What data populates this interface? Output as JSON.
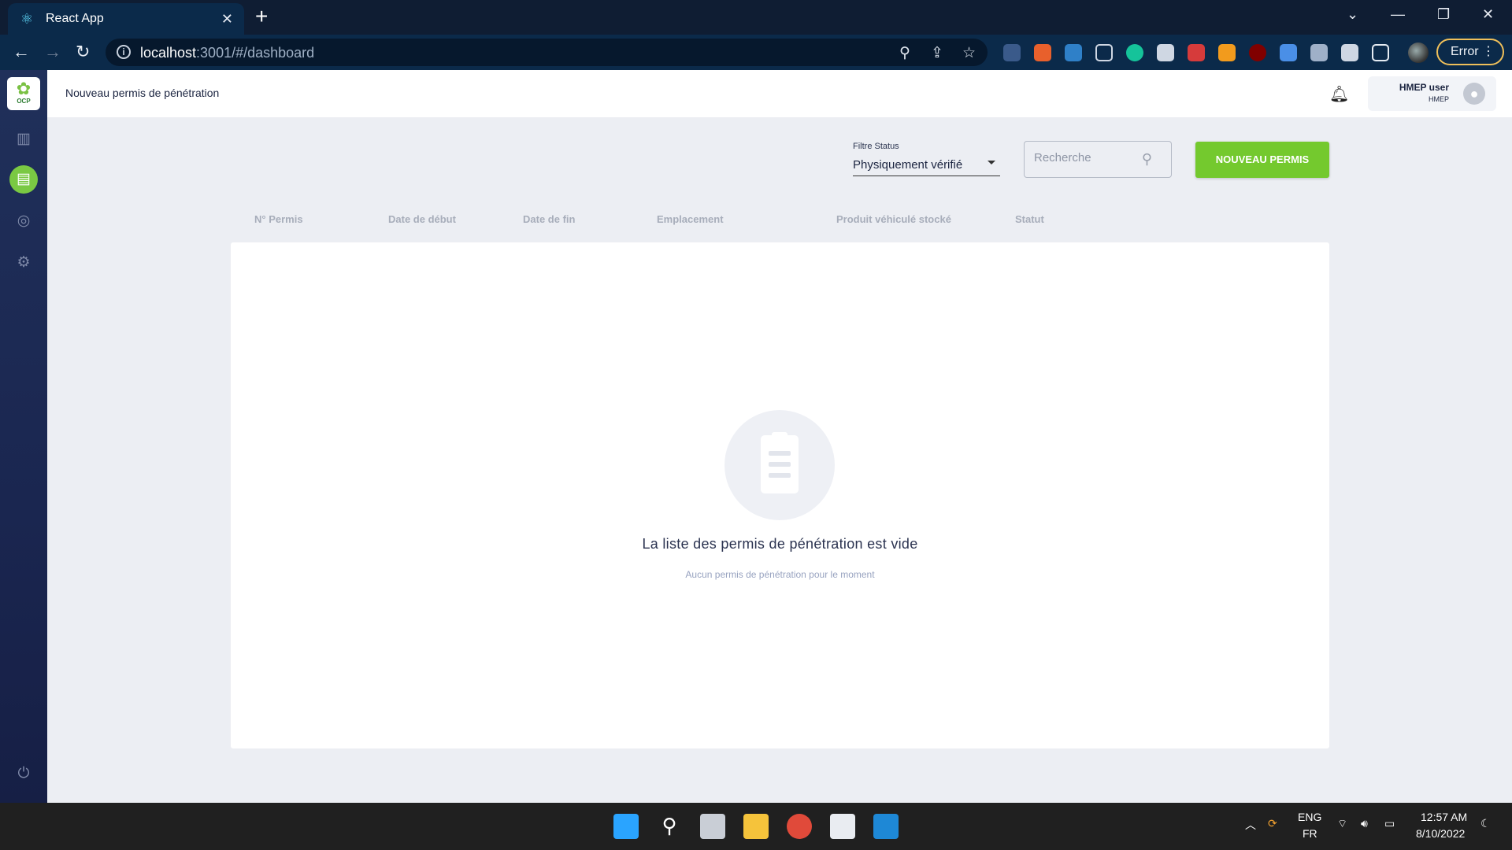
{
  "browser": {
    "tab_title": "React App",
    "url_host": "localhost",
    "url_rest": ":3001/#/dashboard",
    "error_label": "Error",
    "extensions": [
      "pen-extension",
      "off-extension",
      "grid-extension",
      "capture-extension",
      "grammarly-extension",
      "camera-extension",
      "puzzle-red-extension",
      "orange-extension",
      "ublock-extension",
      "screen-extension",
      "shield-extension",
      "puzzle-extension",
      "sidepanel-extension"
    ]
  },
  "app": {
    "logo_text": "OCP",
    "page_title": "Nouveau permis de pénétration",
    "user": {
      "name": "HMEP user",
      "role": "HMEP"
    },
    "sidebar": [
      "dashboard-chart-icon",
      "permit-list-icon",
      "radar-icon",
      "settings-gear-icon",
      "power-icon"
    ]
  },
  "filters": {
    "status_label": "Filtre Status",
    "status_value": "Physiquement vérifié",
    "search_placeholder": "Recherche",
    "new_button_label": "NOUVEAU PERMIS"
  },
  "table": {
    "columns": [
      "N° Permis",
      "Date de début",
      "Date de fin",
      "Emplacement",
      "Produit véhiculé stocké",
      "Statut"
    ],
    "rows": []
  },
  "empty_state": {
    "title": "La liste des permis de pénétration est vide",
    "subtitle": "Aucun permis de pénétration pour le moment"
  },
  "taskbar": {
    "lang_top": "ENG",
    "lang_bottom": "FR",
    "time": "12:57 AM",
    "date": "8/10/2022"
  },
  "colors": {
    "accent_green": "#74c92e",
    "sidebar_bg": "#1a2650",
    "browser_frame": "#0b2a4a"
  }
}
